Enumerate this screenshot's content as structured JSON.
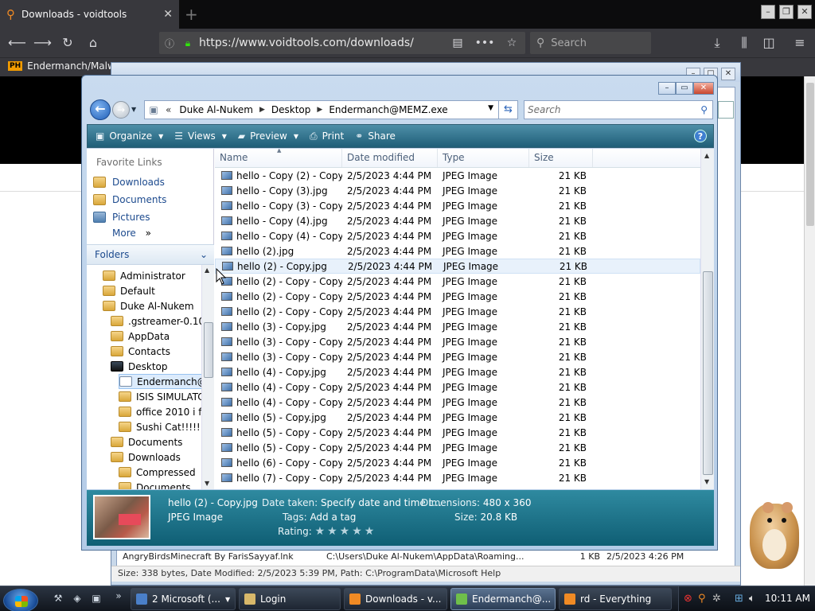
{
  "browser": {
    "tab_title": "Downloads - voidtools",
    "tab_close": "✕",
    "new_tab": "+",
    "url": "https://www.voidtools.com/downloads/",
    "search_placeholder": "Search",
    "bookmark_label": "Endermanch/Malwa",
    "bookmark_icon_text": "PH"
  },
  "everything": {
    "title_partial": "rd - Everything",
    "row": {
      "name": "AngryBirdsMinecraft By FarisSayyaf.lnk",
      "path": "C:\\Users\\Duke Al-Nukem\\AppData\\Roaming...",
      "size": "1 KB",
      "date": "2/5/2023 4:26 PM"
    },
    "status": "Size: 338 bytes, Date Modified: 2/5/2023 5:39 PM, Path: C:\\ProgramData\\Microsoft Help"
  },
  "explorer": {
    "breadcrumb": [
      "Duke Al-Nukem",
      "Desktop",
      "Endermanch@MEMZ.exe"
    ],
    "search_placeholder": "Search",
    "commands": {
      "organize": "Organize",
      "views": "Views",
      "preview": "Preview",
      "print": "Print",
      "share": "Share"
    },
    "favorites_title": "Favorite Links",
    "favorites": [
      "Downloads",
      "Documents",
      "Pictures"
    ],
    "more": "More",
    "folders_label": "Folders",
    "tree": [
      "Administrator",
      "Default",
      "Duke Al-Nukem",
      ".gstreamer-0.10",
      "AppData",
      "Contacts",
      "Desktop",
      "Endermanch@",
      "ISIS SIMULATC",
      "office 2010 i fo",
      "Sushi Cat!!!!!",
      "Documents",
      "Downloads",
      "Compressed",
      "Documents"
    ],
    "columns": [
      "Name",
      "Date modified",
      "Type",
      "Size"
    ],
    "files": [
      {
        "name": "hello - Copy (2) - Copy...",
        "date": "2/5/2023 4:44 PM",
        "type": "JPEG Image",
        "size": "21 KB"
      },
      {
        "name": "hello - Copy (3).jpg",
        "date": "2/5/2023 4:44 PM",
        "type": "JPEG Image",
        "size": "21 KB"
      },
      {
        "name": "hello - Copy (3) - Copy...",
        "date": "2/5/2023 4:44 PM",
        "type": "JPEG Image",
        "size": "21 KB"
      },
      {
        "name": "hello - Copy (4).jpg",
        "date": "2/5/2023 4:44 PM",
        "type": "JPEG Image",
        "size": "21 KB"
      },
      {
        "name": "hello - Copy (4) - Copy...",
        "date": "2/5/2023 4:44 PM",
        "type": "JPEG Image",
        "size": "21 KB"
      },
      {
        "name": "hello (2).jpg",
        "date": "2/5/2023 4:44 PM",
        "type": "JPEG Image",
        "size": "21 KB"
      },
      {
        "name": "hello (2) - Copy.jpg",
        "date": "2/5/2023 4:44 PM",
        "type": "JPEG Image",
        "size": "21 KB"
      },
      {
        "name": "hello (2) - Copy - Copy...",
        "date": "2/5/2023 4:44 PM",
        "type": "JPEG Image",
        "size": "21 KB"
      },
      {
        "name": "hello (2) - Copy - Copy...",
        "date": "2/5/2023 4:44 PM",
        "type": "JPEG Image",
        "size": "21 KB"
      },
      {
        "name": "hello (2) - Copy - Copy...",
        "date": "2/5/2023 4:44 PM",
        "type": "JPEG Image",
        "size": "21 KB"
      },
      {
        "name": "hello (3) - Copy.jpg",
        "date": "2/5/2023 4:44 PM",
        "type": "JPEG Image",
        "size": "21 KB"
      },
      {
        "name": "hello (3) - Copy - Copy...",
        "date": "2/5/2023 4:44 PM",
        "type": "JPEG Image",
        "size": "21 KB"
      },
      {
        "name": "hello (3) - Copy - Copy...",
        "date": "2/5/2023 4:44 PM",
        "type": "JPEG Image",
        "size": "21 KB"
      },
      {
        "name": "hello (4) - Copy.jpg",
        "date": "2/5/2023 4:44 PM",
        "type": "JPEG Image",
        "size": "21 KB"
      },
      {
        "name": "hello (4) - Copy - Copy...",
        "date": "2/5/2023 4:44 PM",
        "type": "JPEG Image",
        "size": "21 KB"
      },
      {
        "name": "hello (4) - Copy - Copy...",
        "date": "2/5/2023 4:44 PM",
        "type": "JPEG Image",
        "size": "21 KB"
      },
      {
        "name": "hello (5) - Copy.jpg",
        "date": "2/5/2023 4:44 PM",
        "type": "JPEG Image",
        "size": "21 KB"
      },
      {
        "name": "hello (5) - Copy - Copy...",
        "date": "2/5/2023 4:44 PM",
        "type": "JPEG Image",
        "size": "21 KB"
      },
      {
        "name": "hello (5) - Copy - Copy...",
        "date": "2/5/2023 4:44 PM",
        "type": "JPEG Image",
        "size": "21 KB"
      },
      {
        "name": "hello (6) - Copy - Copy...",
        "date": "2/5/2023 4:44 PM",
        "type": "JPEG Image",
        "size": "21 KB"
      },
      {
        "name": "hello (7) - Copy - Copy...",
        "date": "2/5/2023 4:44 PM",
        "type": "JPEG Image",
        "size": "21 KB"
      }
    ],
    "selected_index": 6,
    "details": {
      "filename": "hello (2) - Copy.jpg",
      "filetype": "JPEG Image",
      "date_taken_label": "Date taken:",
      "date_taken_value": "Specify date and time t...",
      "dimensions_label": "Dimensions:",
      "dimensions_value": "480 x 360",
      "tags_label": "Tags:",
      "tags_value": "Add a tag",
      "size_label": "Size:",
      "size_value": "20.8 KB",
      "rating_label": "Rating:",
      "rating_stars": "★★★★★"
    }
  },
  "taskbar": {
    "buttons": [
      "2 Microsoft (...",
      "Login",
      "Downloads - v...",
      "Endermanch@...",
      "rd - Everything"
    ],
    "active_index": 3,
    "clock": "10:11 AM"
  },
  "icons": {
    "back": "arrow-left-icon",
    "forward": "arrow-right-icon",
    "reload": "reload-icon",
    "home": "home-icon"
  }
}
